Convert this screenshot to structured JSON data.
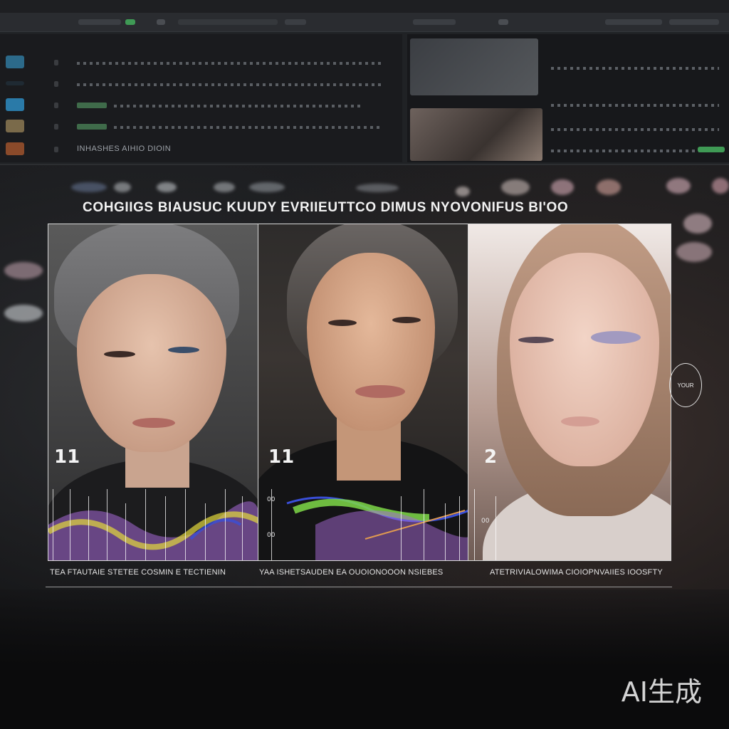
{
  "heading": "COHGIIGS BIAUSUC KUUDY EVRIIEUTTCO DIMUS NYOVONIFUS BI'OO",
  "panels": [
    {
      "number": "11",
      "caption": "TEA FTAUTAIE STETEE COSMIN E TECTIENIN",
      "tick_top": "",
      "tick_bottom": ""
    },
    {
      "number": "11",
      "caption": "YAA ISHETSAUDEN EA OUOIONOOON NSIEBES",
      "tick_top": "00",
      "tick_bottom": "00"
    },
    {
      "number": "2",
      "caption": "ATETRIVIALOWIMA CIOIOPNVAIIES IOOSFTY",
      "tick_top": "",
      "tick_bottom": ""
    }
  ],
  "panel2_side_label": "00",
  "badge_text": "YOUR",
  "left_pane_label": "INHASHES AIHIO DIOIN",
  "watermark": "AI生成",
  "colors": {
    "accent_green": "#3f9a55",
    "wave_purple": "#a86ad8",
    "wave_yellow": "#e2d83c",
    "wave_blue": "#3a4fd8"
  },
  "icons": [
    "thumbnail-icon",
    "status-indicator-icon",
    "chart-wave-icon"
  ]
}
